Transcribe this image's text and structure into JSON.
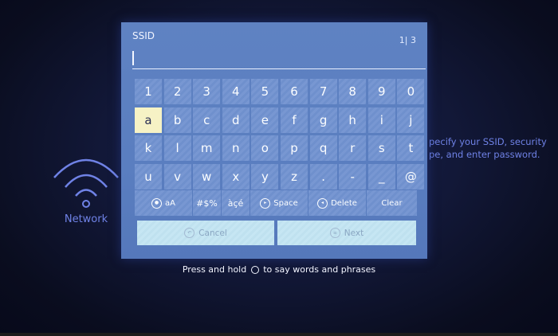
{
  "panel": {
    "title": "SSID",
    "counter": "1| 3"
  },
  "input": {
    "value": ""
  },
  "rows": [
    [
      "1",
      "2",
      "3",
      "4",
      "5",
      "6",
      "7",
      "8",
      "9",
      "0"
    ],
    [
      "a",
      "b",
      "c",
      "d",
      "e",
      "f",
      "g",
      "h",
      "i",
      "j"
    ],
    [
      "k",
      "l",
      "m",
      "n",
      "o",
      "p",
      "q",
      "r",
      "s",
      "t"
    ],
    [
      "u",
      "v",
      "w",
      "x",
      "y",
      "z",
      ".",
      "-",
      "_",
      "@"
    ]
  ],
  "selected_key": "a",
  "modifiers": {
    "case": "aA",
    "symbols": "#$%",
    "accents": "àçé",
    "space": "Space",
    "delete": "Delete",
    "clear": "Clear"
  },
  "actions": {
    "cancel": "Cancel",
    "next": "Next"
  },
  "background": {
    "network_label": "Network",
    "instruction_line1": "pecify your SSID, security",
    "instruction_line2": "pe, and enter password."
  },
  "hint": {
    "before": "Press and hold",
    "after": "to say words and phrases"
  },
  "colors": {
    "panel": "#5a7ec0",
    "key": "#7897d2",
    "selected": "#f6f2c5",
    "action": "#c6e6f3",
    "accent_text": "#6f82e6"
  }
}
